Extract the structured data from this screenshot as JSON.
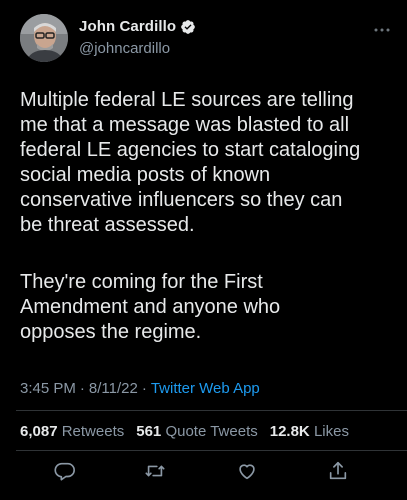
{
  "author": {
    "display_name": "John Cardillo",
    "handle": "@johncardillo",
    "verified_icon": "verified-badge-icon"
  },
  "tweet": {
    "paragraph1": "Multiple federal LE sources are telling\nme that a message was blasted to all\nfederal LE agencies to start cataloging\nsocial media posts of known\nconservative influencers so they can\nbe threat assessed.",
    "paragraph2": "They're coming for the First\nAmendment and anyone who\nopposes the regime."
  },
  "meta": {
    "time": "3:45 PM",
    "sep1": "·",
    "date": "8/11/22",
    "sep2": "·",
    "app": "Twitter Web App"
  },
  "stats": {
    "retweets_count": "6,087",
    "retweets_label": "Retweets",
    "quotes_count": "561",
    "quotes_label": "Quote Tweets",
    "likes_count": "12.8K",
    "likes_label": "Likes"
  },
  "actions": [
    "reply-icon",
    "retweet-icon",
    "like-icon",
    "share-icon"
  ],
  "colors": {
    "background": "#000000",
    "text": "#e7e9ea",
    "secondary": "#8b98a5",
    "link": "#1d9bf0",
    "divider": "#2f3336"
  }
}
